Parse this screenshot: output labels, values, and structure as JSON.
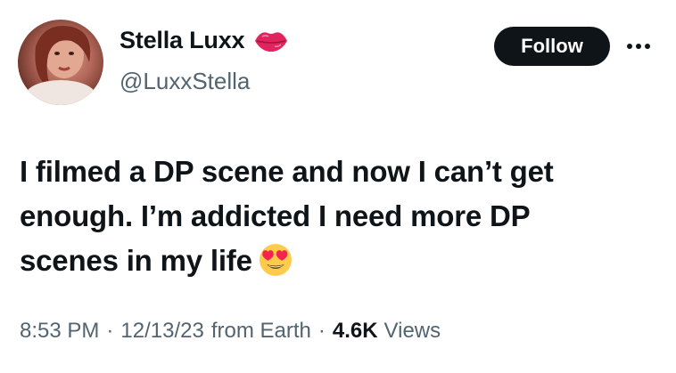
{
  "author": {
    "display_name": "Stella Luxx",
    "handle": "@LuxxStella",
    "name_emoji": "lips-kiss-icon",
    "avatar": "profile-photo"
  },
  "actions": {
    "follow_label": "Follow",
    "more": "more-options-icon"
  },
  "tweet": {
    "line1": "I filmed a DP scene and now I can’t get",
    "line2": "enough. I’m addicted I need more DP",
    "line3": "scenes in my life",
    "trailing_emoji": "heart-eyes-icon"
  },
  "meta": {
    "time": "8:53 PM",
    "date": "12/13/23",
    "location": "from Earth",
    "separator": "·",
    "views_count": "4.6K",
    "views_label": "Views"
  },
  "colors": {
    "text": "#0f1419",
    "secondary": "#536471",
    "follow_bg": "#0f1419",
    "follow_text": "#ffffff",
    "lips": "#e0245e"
  }
}
